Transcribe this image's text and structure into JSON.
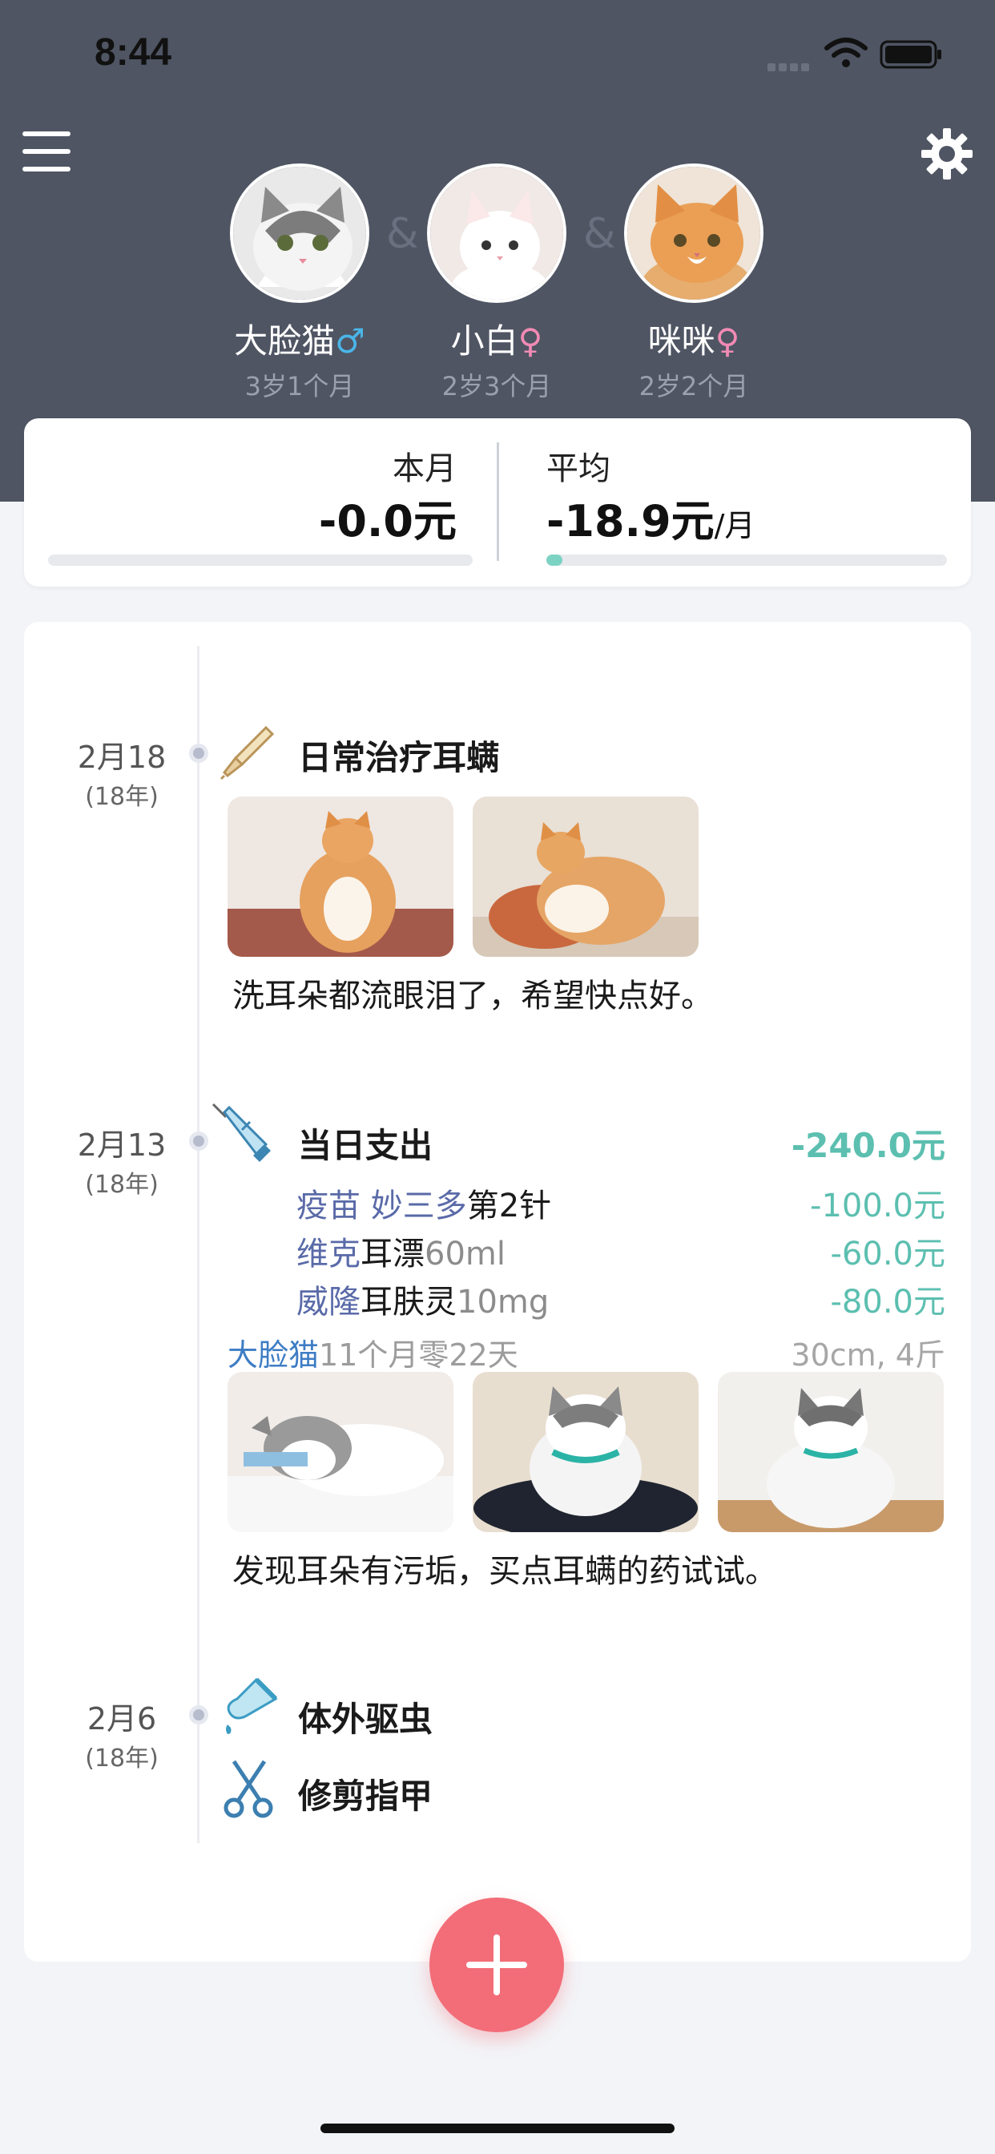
{
  "status_bar": {
    "time": "8:44"
  },
  "header": {
    "menu_icon": "hamburger-menu-icon",
    "settings_icon": "gear-icon",
    "separator": "&",
    "pets": [
      {
        "name": "大脸猫",
        "gender_symbol": "♂",
        "age": "3岁1个月"
      },
      {
        "name": "小白",
        "gender_symbol": "♀",
        "age": "2岁3个月"
      },
      {
        "name": "咪咪",
        "gender_symbol": "♀",
        "age": "2岁2个月"
      }
    ]
  },
  "stats": {
    "this_month_label": "本月",
    "this_month_value": "-0.0元",
    "average_label": "平均",
    "average_value": "-18.9元",
    "average_unit": "/月",
    "this_month_progress": 0,
    "average_progress": 0.04
  },
  "timeline": [
    {
      "date": "2月18",
      "year": "(18年)",
      "icon": "ear-dropper-icon",
      "title": "日常治疗耳螨",
      "note": "洗耳朵都流眼泪了，希望快点好。"
    },
    {
      "date": "2月13",
      "year": "(18年)",
      "icon": "syringe-icon",
      "title": "当日支出",
      "total": "-240.0元",
      "expenses": [
        {
          "brand": "疫苗 妙三多",
          "item": "第2针",
          "spec": "",
          "amount": "-100.0元"
        },
        {
          "brand": "维克",
          "item": "耳漂",
          "spec": "60ml",
          "amount": "-60.0元"
        },
        {
          "brand": "威隆",
          "item": "耳肤灵",
          "spec": "10mg",
          "amount": "-80.0元"
        }
      ],
      "pet_name": "大脸猫",
      "pet_age": "11个月零22天",
      "pet_size": "30cm, 4斤",
      "note": "发现耳朵有污垢，买点耳螨的药试试。"
    },
    {
      "date": "2月6",
      "year": "(18年)",
      "items": [
        {
          "icon": "deworming-drop-icon",
          "title": "体外驱虫"
        },
        {
          "icon": "scissors-icon",
          "title": "修剪指甲"
        }
      ]
    }
  ],
  "fab_icon": "plus-icon"
}
